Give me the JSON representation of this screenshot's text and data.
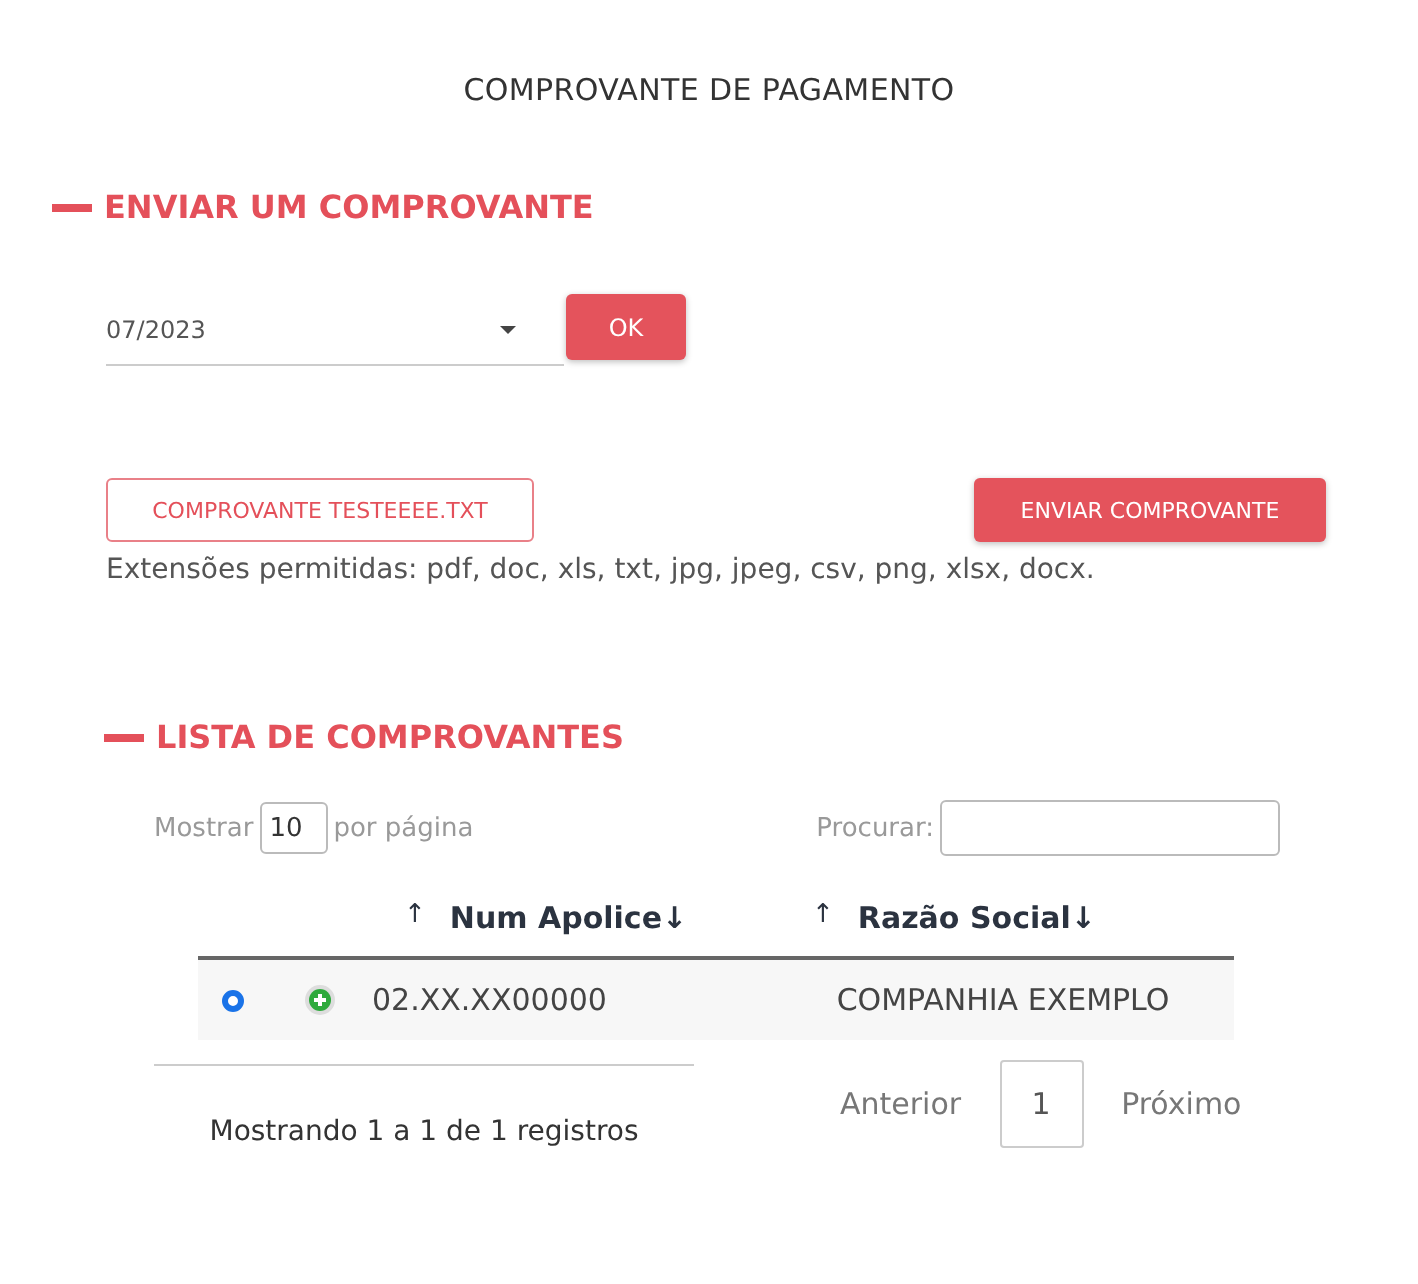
{
  "title": "COMPROVANTE DE PAGAMENTO",
  "upload_section": {
    "heading": "ENVIAR UM COMPROVANTE",
    "period_select": {
      "value": "07/2023"
    },
    "ok_button": "OK",
    "file_button": "COMPROVANTE TESTEEEE.TXT",
    "send_button": "ENVIAR COMPROVANTE",
    "extensions_note": "Extensões permitidas: pdf, doc, xls, txt, jpg, jpeg, csv, png, xlsx, docx."
  },
  "list_section": {
    "heading": "LISTA DE COMPROVANTES",
    "page_size": {
      "before": "Mostrar",
      "value": "10",
      "after": "por página"
    },
    "search": {
      "label": "Procurar:"
    },
    "table": {
      "columns": [
        {
          "sort_up": "↑",
          "label": "Num Apolice↓"
        },
        {
          "sort_up": "↑",
          "label": "Razão Social↓"
        }
      ],
      "rows": [
        {
          "selected": true,
          "cells": [
            "02.XX.XX00000",
            "COMPANHIA EXEMPLO"
          ]
        }
      ]
    },
    "summary": "Mostrando 1 a 1 de 1 registros",
    "pagination": {
      "previous": "Anterior",
      "pages": [
        {
          "label": "1",
          "selected": true
        }
      ],
      "next": "Próximo"
    }
  }
}
